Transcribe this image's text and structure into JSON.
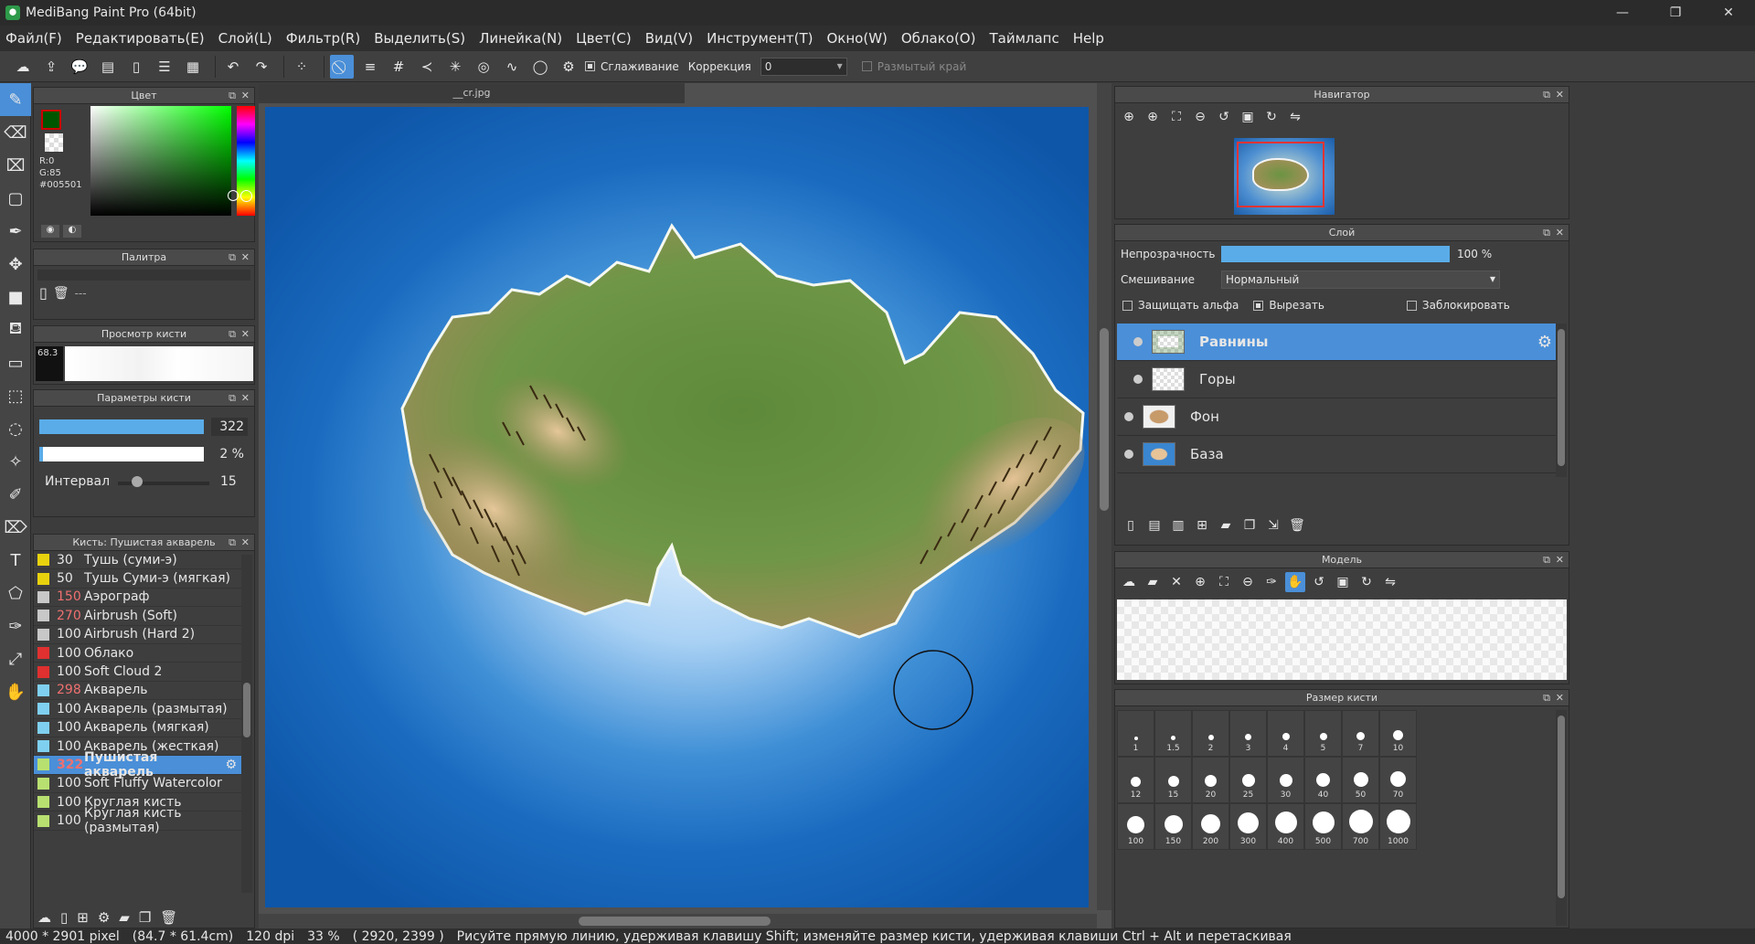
{
  "window": {
    "title": "MediBang Paint Pro (64bit)",
    "minimize": "—",
    "maximize": "❐",
    "close": "✕"
  },
  "menu": [
    "Файл(F)",
    "Редактировать(E)",
    "Слой(L)",
    "Фильтр(R)",
    "Выделить(S)",
    "Линейка(N)",
    "Цвет(C)",
    "Вид(V)",
    "Инструмент(T)",
    "Окно(W)",
    "Облако(O)",
    "Таймлапс",
    "Help"
  ],
  "toolbar": {
    "smoothing_label": "Сглаживание",
    "correction_label": "Коррекция",
    "correction_value": "0",
    "blur_edge_label": "Размытый край"
  },
  "color_panel": {
    "title": "Цвет",
    "r": "R:0",
    "g": "G:85",
    "hex": "#005501",
    "fg_color": "#005501"
  },
  "palette_panel": {
    "title": "Палитра",
    "value": "---"
  },
  "brush_preview": {
    "title": "Просмотр кисти",
    "size": "68.3"
  },
  "brush_params": {
    "title": "Параметры кисти",
    "size": "322",
    "opacity": "2 %",
    "interval_label": "Интервал",
    "interval": "15",
    "size_fraction": 1.0,
    "opacity_fraction": 0.02,
    "interval_fraction": 0.15
  },
  "brush_list": {
    "title": "Кисть: Пушистая акварель",
    "items": [
      {
        "size": "30",
        "name": "Тушь (суми-э)",
        "color": "#e8d20e"
      },
      {
        "size": "50",
        "name": "Тушь Суми-э (мягкая)",
        "color": "#e8d20e"
      },
      {
        "size": "150",
        "name": "Аэрограф",
        "color": "#c8c8c8",
        "red": true
      },
      {
        "size": "270",
        "name": "Airbrush (Soft)",
        "color": "#c8c8c8",
        "red": true
      },
      {
        "size": "100",
        "name": "Airbrush (Hard 2)",
        "color": "#c8c8c8"
      },
      {
        "size": "100",
        "name": "Облако",
        "color": "#e03030"
      },
      {
        "size": "100",
        "name": "Soft Cloud 2",
        "color": "#e03030"
      },
      {
        "size": "298",
        "name": "Акварель",
        "color": "#7fd0f0",
        "red": true
      },
      {
        "size": "100",
        "name": "Акварель (размытая)",
        "color": "#7fd0f0"
      },
      {
        "size": "100",
        "name": "Акварель (мягкая)",
        "color": "#7fd0f0"
      },
      {
        "size": "100",
        "name": "Акварель (жесткая)",
        "color": "#7fd0f0"
      },
      {
        "size": "322",
        "name": "Пушистая акварель",
        "color": "#b8e070",
        "red": true,
        "selected": true
      },
      {
        "size": "100",
        "name": "Soft Fluffy Watercolor",
        "color": "#b8e070"
      },
      {
        "size": "100",
        "name": "Круглая кисть",
        "color": "#b8e070"
      },
      {
        "size": "100",
        "name": "Круглая кисть (размытая)",
        "color": "#b8e070"
      }
    ]
  },
  "document": {
    "tab": "__cr.jpg"
  },
  "navigator": {
    "title": "Навигатор"
  },
  "layer_panel": {
    "title": "Слой",
    "opacity_label": "Непрозрачность",
    "opacity_value": "100 %",
    "opacity_fraction": 1.0,
    "blend_label": "Смешивание",
    "blend_value": "Нормальный",
    "protect_alpha": "Защищать альфа",
    "clip": "Вырезать",
    "lock": "Заблокировать",
    "layers": [
      {
        "name": "Равнины",
        "selected": true
      },
      {
        "name": "Горы"
      },
      {
        "name": "Фон"
      },
      {
        "name": "База"
      }
    ]
  },
  "model_panel": {
    "title": "Модель"
  },
  "brush_size_panel": {
    "title": "Размер кисти",
    "sizes": [
      "1",
      "1.5",
      "2",
      "3",
      "4",
      "5",
      "7",
      "10",
      "12",
      "15",
      "20",
      "25",
      "30",
      "40",
      "50",
      "70",
      "100",
      "150",
      "200",
      "300",
      "400",
      "500",
      "700",
      "1000"
    ]
  },
  "status": {
    "dimensions": "4000 * 2901 pixel",
    "physical": "(84.7 * 61.4cm)",
    "dpi": "120 dpi",
    "zoom": "33 %",
    "cursor": "( 2920, 2399 )",
    "hint": "Рисуйте прямую линию, удерживая клавишу Shift; изменяйте размер кисти, удерживая клавиши Ctrl + Alt и перетаскивая"
  }
}
